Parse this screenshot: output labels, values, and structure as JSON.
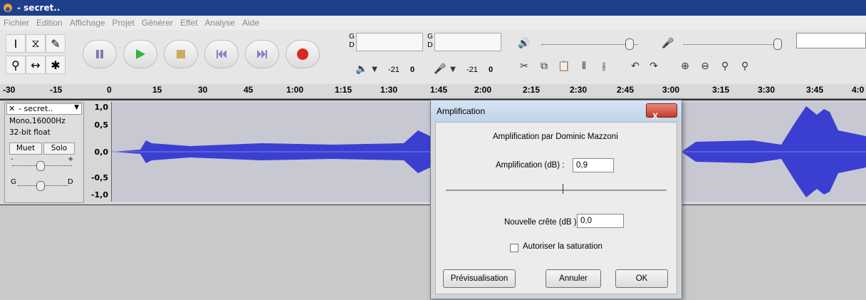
{
  "window": {
    "title": "- secret.."
  },
  "menu": [
    "Fichier",
    "Edition",
    "Affichage",
    "Projet",
    "Générer",
    "Effet",
    "Analyse",
    "Aide"
  ],
  "meters": {
    "play": {
      "top_label": "G",
      "bottom_label": "D",
      "scale": "-21",
      "zero": "0"
    },
    "record": {
      "top_label": "G",
      "bottom_label": "D",
      "scale": "-21",
      "zero": "0"
    }
  },
  "ruler": {
    "ticks": [
      "-30",
      "-15",
      "0",
      "15",
      "30",
      "45",
      "1:00",
      "1:15",
      "1:30",
      "1:45",
      "2:00",
      "2:15",
      "2:30",
      "2:45",
      "3:00",
      "3:15",
      "3:30",
      "3:45",
      "4:0"
    ]
  },
  "track": {
    "name": "- secret..",
    "info_rate": "Mono,16000Hz",
    "info_format": "32-bit float",
    "mute_label": "Muet",
    "solo_label": "Solo",
    "gain_left": "-",
    "gain_right": "+",
    "pan_left": "G",
    "pan_right": "D",
    "y_labels": [
      "1,0",
      "0,5",
      "0,0",
      "-0,5",
      "-1,0"
    ]
  },
  "dialog": {
    "title": "Amplification",
    "close_label": "X",
    "credit": "Amplification par Dominic Mazzoni",
    "amp_label": "Amplification (dB) :",
    "amp_value": "0,9",
    "peak_label": "Nouvelle crête (dB ):",
    "peak_value": "0,0",
    "clip_label": "Autoriser la saturation",
    "preview_label": "Prévisualisation",
    "cancel_label": "Annuler",
    "ok_label": "OK"
  },
  "colors": {
    "waveform": "#3b3fd1",
    "titlebar": "#1e3f8a",
    "record": "#d8281f",
    "play": "#32b33e"
  }
}
